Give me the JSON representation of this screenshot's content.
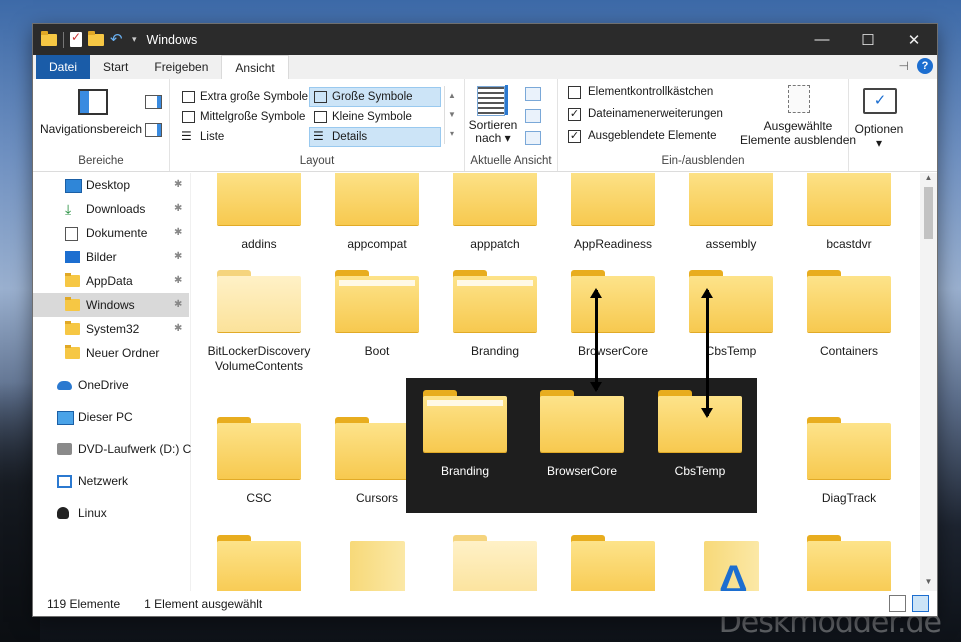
{
  "window": {
    "title": "Windows"
  },
  "tabs": [
    {
      "label": "Datei"
    },
    {
      "label": "Start"
    },
    {
      "label": "Freigeben"
    },
    {
      "label": "Ansicht"
    }
  ],
  "ribbon": {
    "bereiche": {
      "nav_label": "Navigationsbereich",
      "group": "Bereiche"
    },
    "layout": {
      "group": "Layout",
      "items": [
        {
          "label": "Extra große Symbole"
        },
        {
          "label": "Große Symbole"
        },
        {
          "label": "Mittelgroße Symbole"
        },
        {
          "label": "Kleine Symbole"
        },
        {
          "label": "Liste"
        },
        {
          "label": "Details"
        }
      ]
    },
    "view": {
      "sort_label_1": "Sortieren",
      "sort_label_2": "nach",
      "group": "Aktuelle Ansicht"
    },
    "show_hide": {
      "group": "Ein-/ausblenden",
      "checkboxes": [
        {
          "label": "Elementkontrollkästchen",
          "checked": false
        },
        {
          "label": "Dateinamenerweiterungen",
          "checked": true
        },
        {
          "label": "Ausgeblendete Elemente",
          "checked": true
        }
      ],
      "hide_label_1": "Ausgewählte",
      "hide_label_2": "Elemente ausblenden"
    },
    "options": {
      "label": "Optionen"
    }
  },
  "nav": [
    {
      "label": "Desktop"
    },
    {
      "label": "Downloads"
    },
    {
      "label": "Dokumente"
    },
    {
      "label": "Bilder"
    },
    {
      "label": "AppData"
    },
    {
      "label": "Windows"
    },
    {
      "label": "System32"
    },
    {
      "label": "Neuer Ordner"
    },
    {
      "label": "OneDrive"
    },
    {
      "label": "Dieser PC"
    },
    {
      "label": "DVD-Laufwerk (D:) C"
    },
    {
      "label": "Netzwerk"
    },
    {
      "label": "Linux"
    }
  ],
  "folders": [
    {
      "label": "addins"
    },
    {
      "label": "appcompat"
    },
    {
      "label": "apppatch"
    },
    {
      "label": "AppReadiness"
    },
    {
      "label": "assembly"
    },
    {
      "label": "bcastdvr"
    },
    {
      "label": "BitLockerDiscoveryVolumeContents"
    },
    {
      "label": "Boot"
    },
    {
      "label": "Branding"
    },
    {
      "label": "BrowserCore"
    },
    {
      "label": "CbsTemp"
    },
    {
      "label": "Containers"
    },
    {
      "label": "CSC"
    },
    {
      "label": "Cursors"
    },
    {
      "label": "DiagTrack"
    }
  ],
  "overlay": [
    {
      "label": "Branding"
    },
    {
      "label": "BrowserCore"
    },
    {
      "label": "CbsTemp"
    }
  ],
  "status": {
    "count": "119 Elemente",
    "selected": "1 Element ausgewählt"
  },
  "watermark": "Deskmodder.de",
  "colors": {
    "accent": "#1a5ca8",
    "folder": "#f7c94f",
    "titlebar": "#2b2b2b"
  }
}
